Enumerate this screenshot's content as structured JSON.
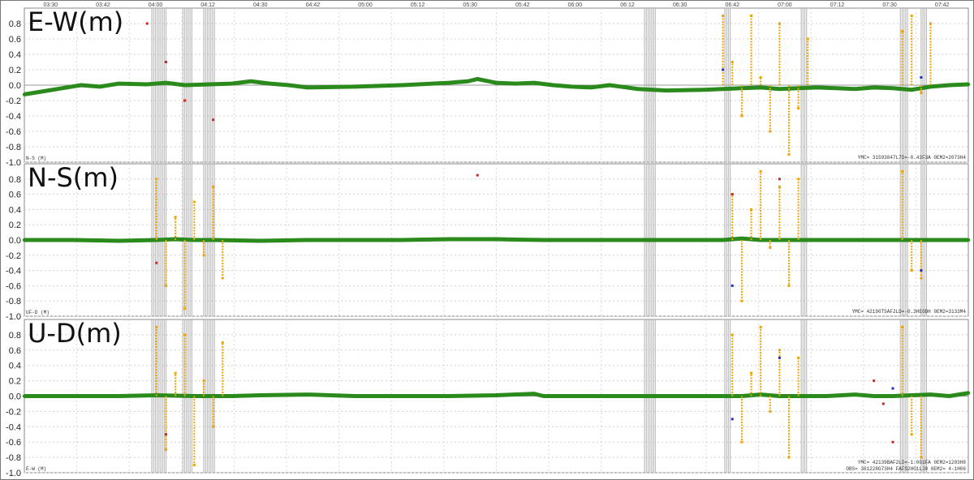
{
  "chart_data": [
    {
      "type": "line",
      "title": "E-W(m)",
      "corner_label": "N-S (M)",
      "footer": "YMC= 31593847L7D=-0.43F3A 0EM2=2073H4",
      "ylim": [
        -1.0,
        1.0
      ],
      "yticks": [
        "0.8",
        "0.6",
        "0.4",
        "0.2",
        "0.0",
        "-0.2",
        "-0.4",
        "-0.6",
        "-0.8",
        "-1.0"
      ],
      "x_tick_labels": [
        "03:30",
        "03:42",
        "04:00",
        "04:12",
        "04:30",
        "04:42",
        "05:00",
        "05:12",
        "05:30",
        "05:42",
        "06:00",
        "06:12",
        "06:30",
        "06:42",
        "07:00",
        "07:12",
        "07:30",
        "07:42"
      ],
      "series": [
        {
          "color": "#2a8a1c",
          "x": [
            0,
            2,
            4,
            6,
            8,
            10,
            13,
            15,
            17,
            22,
            24,
            26,
            28,
            30,
            35,
            40,
            45,
            47,
            48,
            50,
            52,
            54,
            56,
            58,
            60,
            62,
            65,
            68,
            72,
            74,
            76,
            78,
            80,
            82,
            84,
            86,
            88,
            90,
            92,
            94,
            96,
            98,
            100
          ],
          "y": [
            -0.12,
            -0.08,
            -0.04,
            0.0,
            -0.02,
            0.02,
            0.01,
            0.03,
            0.0,
            0.02,
            0.05,
            0.02,
            0.0,
            -0.03,
            -0.02,
            0.0,
            0.03,
            0.05,
            0.08,
            0.03,
            0.02,
            0.03,
            0.0,
            -0.02,
            -0.03,
            0.0,
            -0.05,
            -0.07,
            -0.06,
            -0.05,
            -0.04,
            -0.03,
            -0.05,
            -0.04,
            -0.03,
            -0.04,
            -0.05,
            -0.03,
            -0.04,
            -0.06,
            -0.02,
            0.0,
            0.01
          ]
        },
        {
          "color": "#f0a400",
          "x": [
            74,
            75,
            76,
            77,
            78,
            79,
            80,
            81,
            82,
            83,
            93,
            94,
            95,
            96
          ],
          "y": [
            0.9,
            0.3,
            -0.4,
            0.9,
            0.1,
            -0.6,
            0.8,
            -0.9,
            -0.3,
            0.6,
            0.7,
            0.9,
            -0.1,
            0.8
          ]
        },
        {
          "color": "#d42020",
          "x": [
            13,
            15,
            17,
            20
          ],
          "y": [
            0.8,
            0.3,
            -0.2,
            -0.45
          ]
        },
        {
          "color": "#2030d0",
          "x": [
            74,
            95
          ],
          "y": [
            0.2,
            0.1
          ]
        }
      ]
    },
    {
      "type": "line",
      "title": "N-S(m)",
      "corner_label": "UF-D (M)",
      "footer": "YMC= 42190T5AF2LD=-0.3HE0DH 0EM2=3133M4",
      "ylim": [
        -1.0,
        1.0
      ],
      "yticks": [
        "0.8",
        "0.6",
        "0.4",
        "0.2",
        "0.0",
        "-0.2",
        "-0.4",
        "-0.6",
        "-0.8",
        "-1.0"
      ],
      "series": [
        {
          "color": "#2a8a1c",
          "x": [
            0,
            5,
            10,
            14,
            16,
            18,
            20,
            25,
            30,
            35,
            40,
            45,
            50,
            55,
            60,
            65,
            70,
            74,
            76,
            78,
            80,
            82,
            85,
            88,
            90,
            92,
            94,
            96,
            98,
            100
          ],
          "y": [
            0.0,
            0.0,
            -0.01,
            0.0,
            0.01,
            0.0,
            0.0,
            -0.01,
            0.0,
            0.0,
            0.0,
            0.01,
            0.01,
            0.0,
            0.0,
            0.0,
            0.0,
            0.0,
            0.02,
            0.0,
            0.0,
            0.0,
            0.0,
            0.0,
            0.0,
            0.0,
            0.0,
            0.0,
            0.0,
            0.0
          ]
        },
        {
          "color": "#f0a400",
          "x": [
            14,
            15,
            16,
            17,
            18,
            19,
            20,
            21,
            75,
            76,
            77,
            78,
            79,
            80,
            81,
            82,
            93,
            94,
            95
          ],
          "y": [
            0.8,
            -0.6,
            0.3,
            -0.9,
            0.5,
            -0.2,
            0.7,
            -0.5,
            0.6,
            -0.8,
            0.4,
            0.9,
            -0.1,
            0.7,
            -0.6,
            0.8,
            0.9,
            -0.4,
            -0.5
          ]
        },
        {
          "color": "#d42020",
          "x": [
            14,
            48,
            75,
            80
          ],
          "y": [
            -0.3,
            0.85,
            0.6,
            0.8
          ]
        },
        {
          "color": "#2030d0",
          "x": [
            75,
            95
          ],
          "y": [
            -0.6,
            -0.4
          ]
        }
      ]
    },
    {
      "type": "line",
      "title": "U-D(m)",
      "corner_label": "E-W (M)",
      "footer": "YMC= 42139BAF2LD=-1:0G1FA 0EM2=1203H8",
      "footer2": "OBS= 361228G73H4 FAFS2HO1LJ0 0EM2= 4-1H06",
      "ylim": [
        -1.0,
        1.0
      ],
      "yticks": [
        "0.8",
        "0.6",
        "0.4",
        "0.2",
        "0.0",
        "-0.2",
        "-0.4",
        "-0.6",
        "-0.8",
        "-1.0"
      ],
      "series": [
        {
          "color": "#2a8a1c",
          "x": [
            0,
            5,
            10,
            14,
            18,
            22,
            25,
            30,
            35,
            40,
            45,
            50,
            54,
            55,
            60,
            65,
            70,
            74,
            76,
            78,
            80,
            82,
            85,
            88,
            90,
            92,
            94,
            96,
            98,
            100
          ],
          "y": [
            0.0,
            0.0,
            0.0,
            0.01,
            0.0,
            0.0,
            0.01,
            0.02,
            0.0,
            0.0,
            0.0,
            0.01,
            0.03,
            0.0,
            0.0,
            0.0,
            0.0,
            0.0,
            0.0,
            0.02,
            0.0,
            0.0,
            0.0,
            0.02,
            0.0,
            0.0,
            0.01,
            0.02,
            0.0,
            0.04
          ]
        },
        {
          "color": "#f0a400",
          "x": [
            14,
            15,
            16,
            17,
            18,
            19,
            20,
            21,
            75,
            76,
            77,
            78,
            79,
            80,
            81,
            82,
            93,
            94,
            95
          ],
          "y": [
            0.9,
            -0.7,
            0.3,
            0.8,
            -0.9,
            0.2,
            -0.4,
            0.7,
            0.8,
            -0.6,
            0.3,
            0.9,
            -0.2,
            0.6,
            -0.8,
            0.5,
            0.9,
            -0.5,
            -0.8
          ]
        },
        {
          "color": "#d42020",
          "x": [
            15,
            90,
            91,
            92
          ],
          "y": [
            -0.5,
            0.2,
            -0.1,
            -0.6
          ]
        },
        {
          "color": "#2030d0",
          "x": [
            75,
            80,
            92
          ],
          "y": [
            -0.3,
            0.5,
            0.1
          ]
        }
      ]
    }
  ]
}
